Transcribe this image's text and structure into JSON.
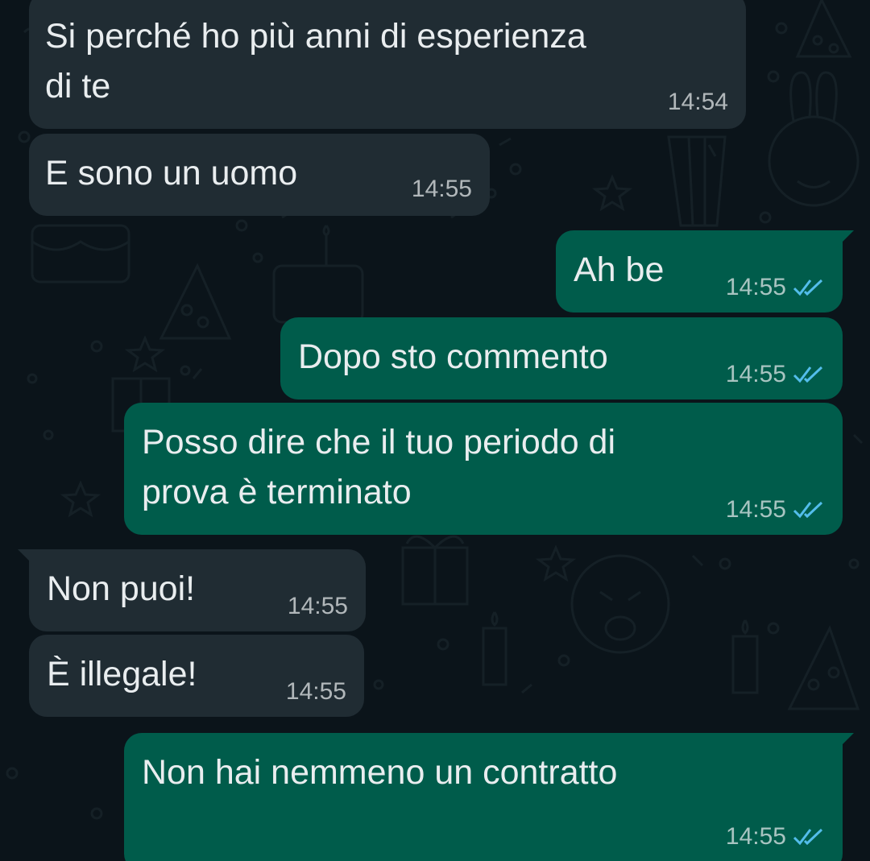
{
  "theme": {
    "background": "#0b141a",
    "incoming_bubble": "#202c33",
    "outgoing_bubble": "#005c4b",
    "text": "#e9edef",
    "read_ticks": "#53bdeb"
  },
  "messages": [
    {
      "direction": "incoming",
      "lines": [
        "Si perché ho più anni di esperienza",
        "di te"
      ],
      "time": "14:54"
    },
    {
      "direction": "incoming",
      "lines": [
        "E sono un uomo"
      ],
      "time": "14:55"
    },
    {
      "direction": "outgoing",
      "lines": [
        "Ah be"
      ],
      "time": "14:55",
      "status": "read-double-tick-icon"
    },
    {
      "direction": "outgoing",
      "lines": [
        "Dopo sto commento"
      ],
      "time": "14:55",
      "status": "read-double-tick-icon"
    },
    {
      "direction": "outgoing",
      "lines": [
        "Posso dire che il tuo periodo di",
        "prova è terminato"
      ],
      "time": "14:55",
      "status": "read-double-tick-icon"
    },
    {
      "direction": "incoming",
      "lines": [
        "Non puoi!"
      ],
      "time": "14:55"
    },
    {
      "direction": "incoming",
      "lines": [
        "È illegale!"
      ],
      "time": "14:55"
    },
    {
      "direction": "outgoing",
      "lines": [
        "Non hai nemmeno un contratto"
      ],
      "time": "14:55",
      "status": "read-double-tick-icon"
    }
  ]
}
